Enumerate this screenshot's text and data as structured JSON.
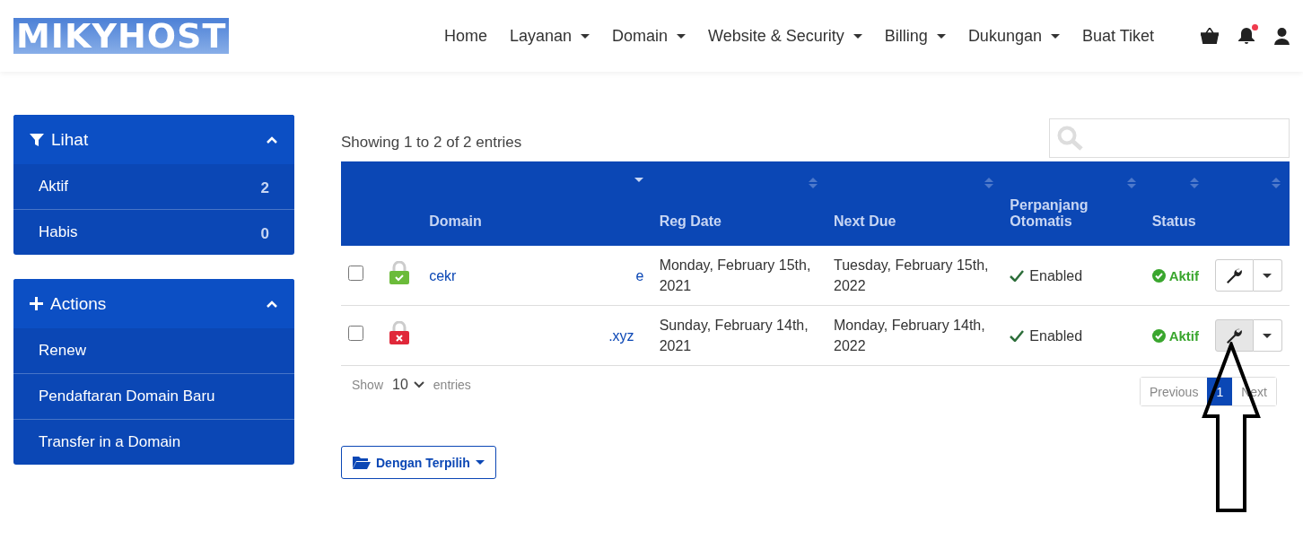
{
  "logo": "MIKYHOST",
  "nav": [
    {
      "label": "Home",
      "dropdown": false
    },
    {
      "label": "Layanan",
      "dropdown": true
    },
    {
      "label": "Domain",
      "dropdown": true
    },
    {
      "label": "Website & Security",
      "dropdown": true
    },
    {
      "label": "Billing",
      "dropdown": true
    },
    {
      "label": "Dukungan",
      "dropdown": true
    },
    {
      "label": "Buat Tiket",
      "dropdown": false
    }
  ],
  "notifications": {
    "unread": true
  },
  "sidebar": [
    {
      "title": "Lihat",
      "expanded": true,
      "items": [
        {
          "label": "Aktif",
          "count": "2"
        },
        {
          "label": "Habis",
          "count": "0"
        }
      ]
    },
    {
      "title": "Actions",
      "expanded": true,
      "items": [
        {
          "label": "Renew"
        },
        {
          "label": "Pendaftaran Domain Baru"
        },
        {
          "label": "Transfer in a Domain"
        }
      ]
    }
  ],
  "summary": "Showing 1 to 2 of 2 entries",
  "table": {
    "columns": [
      {
        "label": "Domain",
        "sorted": true
      },
      {
        "label": "Reg Date",
        "sorted": false
      },
      {
        "label": "Next Due",
        "sorted": false
      },
      {
        "label": "Perpanjang Otomatis",
        "sorted": false
      },
      {
        "label": "Status",
        "sorted": false
      },
      {
        "sorted": false
      }
    ],
    "rows": [
      {
        "checked": false,
        "secure": true,
        "domain_start": "cekr",
        "domain_end": "e",
        "reg_date": "Monday, February 15th, 2021",
        "next_due": "Tuesday, February 15th, 2022",
        "auto_renew": "Enabled",
        "status": "Aktif",
        "pressed": false
      },
      {
        "checked": false,
        "secure": false,
        "domain_end": ".xyz",
        "reg_date": "Sunday, February 14th, 2021",
        "next_due": "Monday, February 14th, 2022",
        "auto_renew": "Enabled",
        "status": "Aktif",
        "pressed": true
      }
    ]
  },
  "length": {
    "show": "Show",
    "value": "10",
    "entries": "entries"
  },
  "pagination": [
    {
      "label": "Previous",
      "selected": false
    },
    {
      "label": "1",
      "selected": true
    },
    {
      "label": "Next",
      "selected": false
    }
  ],
  "bulk_button": "Dengan Terpilih"
}
